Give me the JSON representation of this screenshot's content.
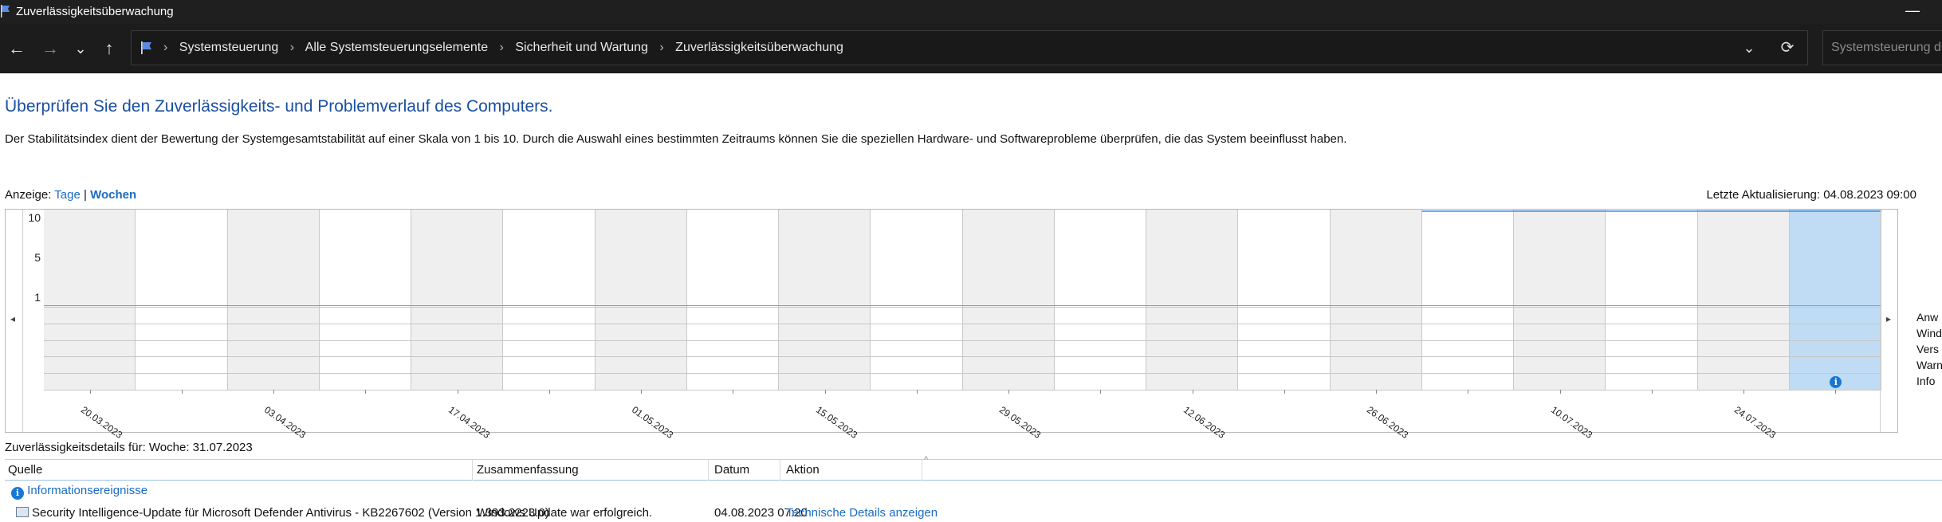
{
  "window": {
    "title": "Zuverlässigkeitsüberwachung",
    "minimize_glyph": "—"
  },
  "nav": {
    "back_glyph": "←",
    "forward_glyph": "→",
    "recent_glyph": "⌄",
    "up_glyph": "↑"
  },
  "address": {
    "breadcrumbs": [
      "Systemsteuerung",
      "Alle Systemsteuerungselemente",
      "Sicherheit und Wartung",
      "Zuverlässigkeitsüberwachung"
    ],
    "separator": "›",
    "dropdown_glyph": "⌄",
    "refresh_glyph": "⟳"
  },
  "search": {
    "placeholder": "Systemsteuerung durchsuchen"
  },
  "page": {
    "heading": "Überprüfen Sie den Zuverlässigkeits- und Problemverlauf des Computers.",
    "description": "Der Stabilitätsindex dient der Bewertung der Systemgesamtstabilität auf einer Skala von 1 bis 10. Durch die Auswahl eines bestimmten Zeitraums können Sie die speziellen Hardware- und Softwareprobleme überprüfen, die das System beeinflusst haben.",
    "view_label": "Anzeige:",
    "view_days": "Tage",
    "view_sep": "|",
    "view_weeks": "Wochen",
    "last_update": "Letzte Aktualisierung: 04.08.2023 09:00"
  },
  "chart_data": {
    "type": "line",
    "title": "",
    "y_ticks": [
      "10",
      "5",
      "1"
    ],
    "ylim": [
      1,
      10
    ],
    "columns": 20,
    "selected_column": 19,
    "x_labels": [
      "20.03.2023",
      "03.04.2023",
      "17.04.2023",
      "01.05.2023",
      "15.05.2023",
      "29.05.2023",
      "12.06.2023",
      "26.06.2023",
      "10.07.2023",
      "24.07.2023"
    ],
    "stability_index": {
      "start_column": 15,
      "end_column": 19,
      "value": 10
    },
    "event_rows": [
      "Anwendungsfehler",
      "Windows-Fehler",
      "Verschiedene Fehler",
      "Warnungen",
      "Informationen"
    ],
    "legend_visible": [
      "Anw",
      "Wind",
      "Vers",
      "Warn",
      "Info"
    ],
    "info_event_column": 19,
    "scroll_left_glyph": "◂",
    "scroll_right_glyph": "▸"
  },
  "details": {
    "title": "Zuverlässigkeitsdetails für: Woche: 31.07.2023",
    "columns": [
      "Quelle",
      "Zusammenfassung",
      "Datum",
      "Aktion"
    ],
    "group_label": "Informationsereignisse",
    "info_glyph": "i",
    "rows": [
      {
        "source": "Security Intelligence-Update für Microsoft Defender Antivirus - KB2267602 (Version 1.393.2223.0)",
        "summary": "Windows Update war erfolgreich.",
        "date": "04.08.2023 07:20",
        "action": "Technische Details anzeigen"
      }
    ]
  },
  "colors": {
    "heading": "#1a4fa0",
    "link": "#1a6bc4",
    "selection": "#bfdcf4",
    "info": "#1778d2"
  }
}
